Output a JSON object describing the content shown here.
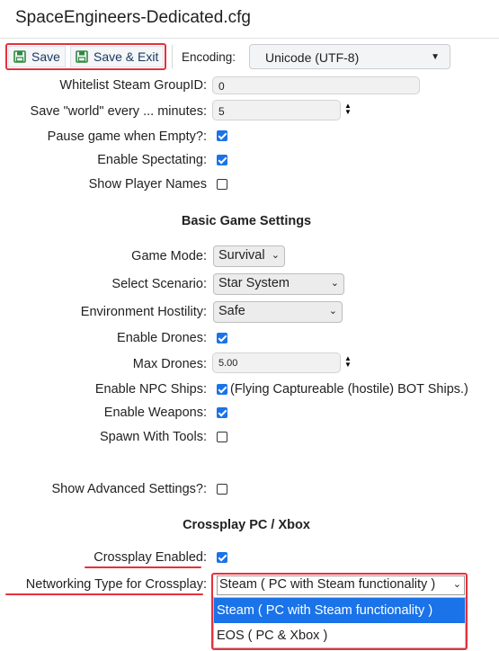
{
  "window": {
    "title": "SpaceEngineers-Dedicated.cfg"
  },
  "toolbar": {
    "save_label": "Save",
    "save_exit_label": "Save & Exit",
    "encoding_label": "Encoding:",
    "encoding_value": "Unicode (UTF-8)"
  },
  "settings": {
    "whitelist_label": "Whitelist Steam GroupID:",
    "whitelist_value": "0",
    "save_world_label": "Save \"world\" every ... minutes:",
    "save_world_value": "5",
    "pause_label": "Pause game when Empty?:",
    "pause_checked": true,
    "spectating_label": "Enable Spectating:",
    "spectating_checked": true,
    "player_names_label": "Show Player Names",
    "player_names_checked": false
  },
  "basic": {
    "heading": "Basic Game Settings",
    "game_mode_label": "Game Mode:",
    "game_mode_value": "Survival",
    "scenario_label": "Select Scenario:",
    "scenario_value": "Star System",
    "hostility_label": "Environment Hostility:",
    "hostility_value": "Safe",
    "drones_label": "Enable Drones:",
    "drones_checked": true,
    "max_drones_label": "Max Drones:",
    "max_drones_value": "5.00",
    "npc_label": "Enable NPC Ships:",
    "npc_checked": true,
    "npc_note": "(Flying Captureable (hostile) BOT Ships.)",
    "weapons_label": "Enable Weapons:",
    "weapons_checked": true,
    "tools_label": "Spawn With Tools:",
    "tools_checked": false,
    "advanced_label": "Show Advanced Settings?:",
    "advanced_checked": false
  },
  "crossplay": {
    "heading": "Crossplay PC / Xbox",
    "enabled_label": "Crossplay Enabled:",
    "enabled_checked": true,
    "networking_label": "Networking Type for Crossplay:",
    "networking_value": "Steam ( PC with Steam functionality )",
    "options": [
      "Steam ( PC with Steam functionality )",
      "EOS ( PC & Xbox )"
    ]
  },
  "colors": {
    "accent": "#1a73e8",
    "highlight": "#e4313c",
    "selected_option_bg": "#1a73e8"
  }
}
